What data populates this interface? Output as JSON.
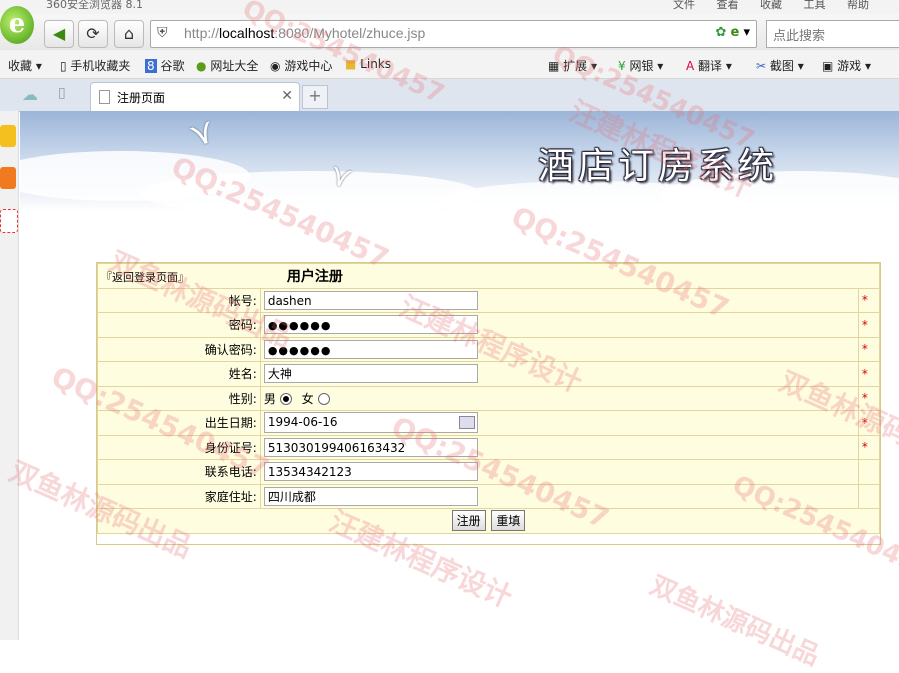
{
  "browser": {
    "title": "360安全浏览器 8.1",
    "menu": [
      "文件",
      "查看",
      "收藏",
      "工具",
      "帮助"
    ],
    "address": {
      "prefix": "http://",
      "host": "localhost",
      "rest": ":8080/Myhotel/zhuce.jsp"
    },
    "search_placeholder": "点此搜索",
    "favorites": [
      "收藏",
      "手机收藏夹",
      "谷歌",
      "网址大全",
      "游戏中心",
      "Links"
    ],
    "tools": [
      "扩展",
      "网银",
      "翻译",
      "截图",
      "游戏"
    ],
    "tab_label": "注册页面",
    "newtab_label": "+"
  },
  "banner": {
    "title": "酒店订房系统"
  },
  "form": {
    "back_link": "『返回登录页面』",
    "title": "用户注册",
    "required_mark": "*",
    "fields": [
      {
        "label": "帐号:",
        "value": "dashen"
      },
      {
        "label": "密码:",
        "value": "●●●●●●"
      },
      {
        "label": "确认密码:",
        "value": "●●●●●●"
      },
      {
        "label": "姓名:",
        "value": "大神"
      },
      {
        "label": "性别:",
        "male": "男",
        "female": "女",
        "selected": "男"
      },
      {
        "label": "出生日期:",
        "value": "1994-06-16"
      },
      {
        "label": "身份证号:",
        "value": "513030199406163432"
      },
      {
        "label": "联系电话:",
        "value": "13534342123"
      },
      {
        "label": "家庭住址:",
        "value": "四川成都"
      }
    ],
    "submit_label": "注册",
    "reset_label": "重填"
  },
  "watermarks": [
    "QQ:254540457",
    "汪建林程序设计",
    "双鱼林源码出品"
  ]
}
